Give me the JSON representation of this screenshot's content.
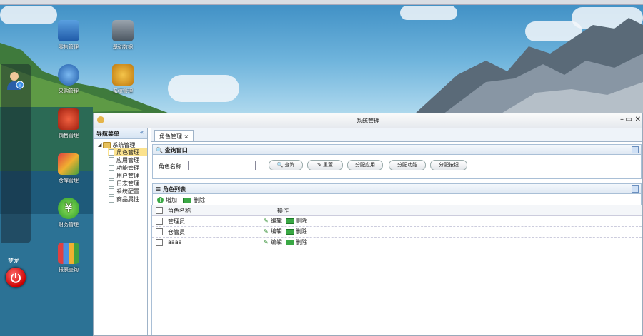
{
  "desktop": {
    "icons": [
      {
        "id": "retail",
        "label": "零售管理"
      },
      {
        "id": "basic",
        "label": "基础数据"
      },
      {
        "id": "purchase",
        "label": "采购管理"
      },
      {
        "id": "system",
        "label": "系统管理"
      },
      {
        "id": "sales",
        "label": "销售管理"
      },
      {
        "id": "warehouse",
        "label": "仓库管理"
      },
      {
        "id": "finance",
        "label": "财务管理"
      },
      {
        "id": "report",
        "label": "报表查询"
      }
    ],
    "power_label": "梦龙"
  },
  "window": {
    "title": "系统管理",
    "controls": {
      "minimize": "–",
      "maximize": "▭",
      "close": "✕"
    }
  },
  "nav": {
    "title": "导航菜单",
    "collapse": "«",
    "root": "系统管理",
    "items": [
      "角色管理",
      "应用管理",
      "功能管理",
      "用户管理",
      "日志管理",
      "系统配置",
      "商品属性"
    ],
    "selected_index": 0
  },
  "tabs": [
    {
      "label": "角色管理",
      "close": "×"
    }
  ],
  "query": {
    "title": "查询窗口",
    "label": "角色名称:",
    "value": "",
    "buttons": {
      "search": "查询",
      "reset": "重置",
      "assign_app": "分配应用",
      "assign_func": "分配功能",
      "assign_btn": "分配按钮"
    }
  },
  "list": {
    "title": "角色列表",
    "add": "增加",
    "delete": "删除",
    "columns": [
      "角色名称",
      "操作"
    ],
    "rows": [
      {
        "name": "管理员"
      },
      {
        "name": "仓管员"
      },
      {
        "name": "aaaa"
      }
    ],
    "op_edit": "编辑",
    "op_delete": "删除"
  },
  "colors": {
    "accent": "#3a6fb0",
    "selected": "#fbe28e",
    "border": "#9fb3c8"
  }
}
